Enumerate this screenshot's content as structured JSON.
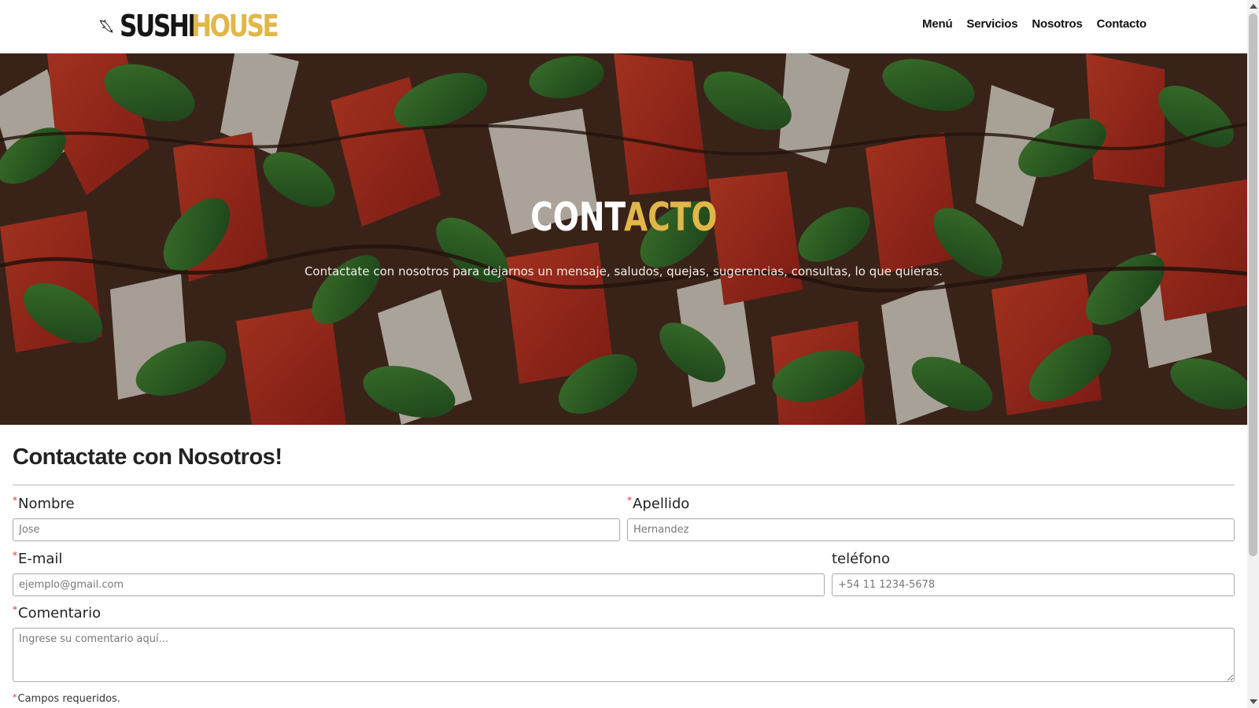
{
  "nav": {
    "logo_part1": "SUSHI",
    "logo_part2": "HOUSE",
    "links": [
      "Menú",
      "Servicios",
      "Nosotros",
      "Contacto"
    ]
  },
  "hero": {
    "title_part1": "CONT",
    "title_part2": "ACTO",
    "subtitle": "Contactate con nosotros para dejarnos un mensaje, saludos, quejas, sugerencias, consultas, lo que quieras."
  },
  "form": {
    "title": "Contactate con Nosotros!",
    "required_mark": "*",
    "nombre": {
      "label": "Nombre",
      "placeholder": "Jose"
    },
    "apellido": {
      "label": "Apellido",
      "placeholder": "Hernandez"
    },
    "email": {
      "label": "E-mail",
      "placeholder": "ejemplo@gmail.com"
    },
    "telefono": {
      "label": "teléfono",
      "placeholder": "+54 11 1234-5678"
    },
    "comentario": {
      "label": "Comentario",
      "placeholder": "Ingrese su comentario aquí..."
    },
    "required_note": "Campos requeridos."
  },
  "colors": {
    "accent": "#e0b748",
    "required": "#d9333f"
  },
  "icons": {
    "logo_icon": "fish-icon"
  }
}
